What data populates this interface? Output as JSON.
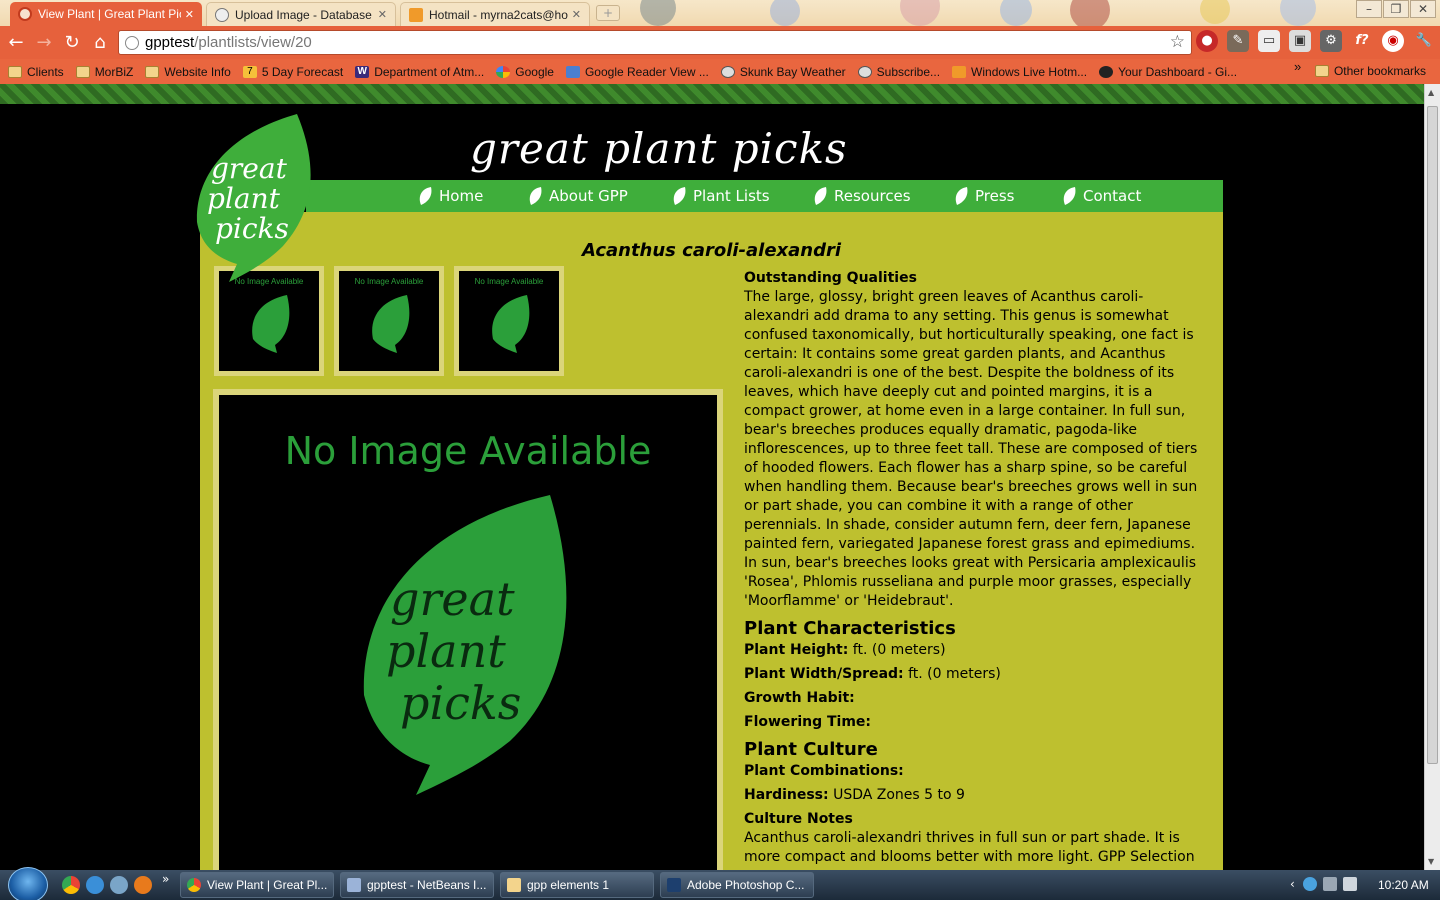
{
  "browser": {
    "tabs": [
      {
        "title": "View Plant | Great Plant Pick",
        "active": true,
        "icon": "chrome-page-icon"
      },
      {
        "title": "Upload Image - Database A",
        "active": false,
        "icon": "globe-icon"
      },
      {
        "title": "Hotmail - myrna2cats@hot",
        "active": false,
        "icon": "hotmail-icon"
      }
    ],
    "url_host": "gpptest",
    "url_path": "/plantlists/view/20",
    "bookmarks": [
      {
        "label": "Clients",
        "icon": "folder-icon"
      },
      {
        "label": "MorBiZ",
        "icon": "folder-icon"
      },
      {
        "label": "Website Info",
        "icon": "folder-icon"
      },
      {
        "label": "5 Day Forecast",
        "icon": "weather-icon"
      },
      {
        "label": "Department of Atm...",
        "icon": "w-icon"
      },
      {
        "label": "Google",
        "icon": "google-icon"
      },
      {
        "label": "Google Reader View ...",
        "icon": "reader-icon"
      },
      {
        "label": "Skunk Bay Weather",
        "icon": "globe-icon"
      },
      {
        "label": "Subscribe...",
        "icon": "globe-icon"
      },
      {
        "label": "Windows Live Hotm...",
        "icon": "hotmail-icon"
      },
      {
        "label": "Your Dashboard - Gi...",
        "icon": "github-icon"
      }
    ],
    "bookmarks_more": "»",
    "other_bookmarks": "Other bookmarks",
    "colors": {
      "accent": "#e6613c"
    }
  },
  "site": {
    "title": "great plant picks",
    "logo_text": [
      "great",
      "plant",
      "picks"
    ],
    "nav": [
      "Home",
      "About GPP",
      "Plant Lists",
      "Resources",
      "Press",
      "Contact"
    ],
    "colors": {
      "nav": "#3fae3b",
      "content": "#bec02f",
      "leaf": "#2b9f3a"
    }
  },
  "plant": {
    "name": "Acanthus caroli-alexandri",
    "thumbnail_caption": "No Image Available",
    "thumbnails": 3,
    "main_image_caption": "No Image Available",
    "outstanding_heading": "Outstanding Qualities",
    "outstanding_text": "The large, glossy, bright green leaves of Acanthus caroli-alexandri add drama to any setting. This genus is somewhat confused taxonomically, but horticulturally speaking, one fact is certain: It contains some great garden plants, and Acanthus caroli-alexandri is one of the best. Despite the boldness of its leaves, which have deeply cut and pointed margins, it is a compact grower, at home even in a large container. In full sun, bear's breeches produces equally dramatic, pagoda-like inflorescences, up to three feet tall. These are composed of tiers of hooded flowers. Each flower has a sharp spine, so be careful when handling them. Because bear's breeches grows well in sun or part shade, you can combine it with a range of other perennials. In shade, consider autumn fern, deer fern, Japanese painted fern, variegated Japanese forest grass and epimediums. In sun, bear's breeches looks great with Persicaria amplexicaulis 'Rosea', Phlomis russeliana and purple moor grasses, especially 'Moorflamme' or 'Heidebraut'.",
    "characteristics_heading": "Plant Characteristics",
    "height_label": "Plant Height:",
    "height_value": " ft. (0 meters)",
    "width_label": "Plant Width/Spread:",
    "width_value": " ft. (0 meters)",
    "growth_label": "Growth Habit:",
    "flowering_label": "Flowering Time:",
    "culture_heading": "Plant Culture",
    "combinations_label": "Plant Combinations:",
    "hardiness_label": "Hardiness:",
    "hardiness_value": " USDA Zones 5 to 9",
    "culture_notes_heading": "Culture Notes",
    "culture_notes_text": "Acanthus caroli-alexandri thrives in full sun or part shade. It is more compact and blooms better with more light. GPP Selection"
  },
  "taskbar": {
    "start": "start-orb",
    "quicklaunch_more": "»",
    "tasks": [
      {
        "label": "View Plant | Great Pl...",
        "icon": "chrome-icon"
      },
      {
        "label": "gpptest - NetBeans I...",
        "icon": "netbeans-icon"
      },
      {
        "label": "gpp elements 1",
        "icon": "folder-icon"
      },
      {
        "label": "Adobe Photoshop C...",
        "icon": "photoshop-icon"
      }
    ],
    "clock": "10:20 AM"
  }
}
